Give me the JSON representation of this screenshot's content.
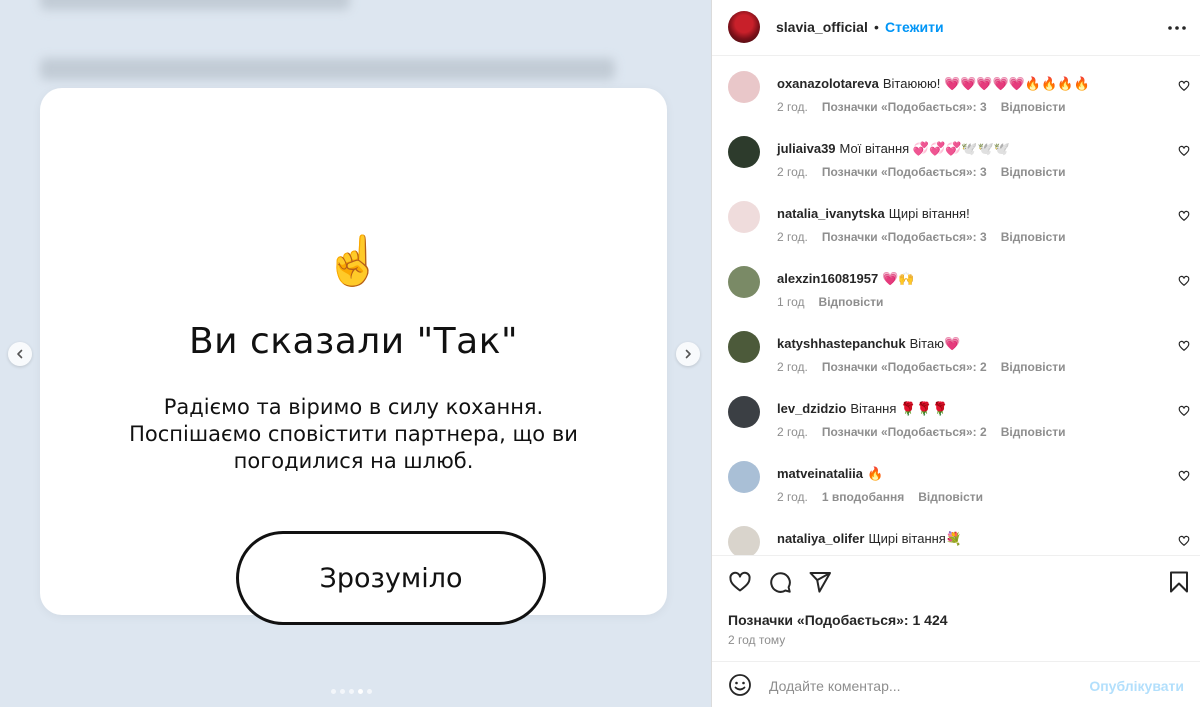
{
  "media": {
    "emoji": "☝️",
    "title": "Ви сказали \"Так\"",
    "body_lines": [
      "Радіємо та віримо в силу кохання.",
      "Поспішаємо сповістити партнера, що ви",
      "погодилися на шлюб."
    ],
    "confirm_label": "Зрозуміло",
    "carousel": {
      "count": 5,
      "active_index": 3
    }
  },
  "header": {
    "username": "slavia_official",
    "separator": "•",
    "follow_label": "Стежити"
  },
  "comments": [
    {
      "user": "oxanazolotareva",
      "text": "Вітаююю! 💗💗💗💗💗🔥🔥🔥🔥",
      "time": "2 год.",
      "likes": "Позначки «Подобається»: 3",
      "reply": "Відповісти",
      "avatar_color": "#e9c7c9"
    },
    {
      "user": "juliaiva39",
      "text": "Мої вітання 💞💞💞🕊️🕊️🕊️",
      "time": "2 год.",
      "likes": "Позначки «Подобається»: 3",
      "reply": "Відповісти",
      "avatar_color": "#2d3b2c"
    },
    {
      "user": "natalia_ivanytska",
      "text": "Щирі вітання!",
      "time": "2 год.",
      "likes": "Позначки «Подобається»: 3",
      "reply": "Відповісти",
      "avatar_color": "#efdcdc"
    },
    {
      "user": "alexzin16081957",
      "text": "💗🙌",
      "time": "1 год",
      "likes": "",
      "reply": "Відповісти",
      "avatar_color": "#7a8a66"
    },
    {
      "user": "katyshhastepanchuk",
      "text": "Вітаю💗",
      "time": "2 год.",
      "likes": "Позначки «Подобається»: 2",
      "reply": "Відповісти",
      "avatar_color": "#4c5a3a"
    },
    {
      "user": "lev_dzidzio",
      "text": "Вітання 🌹🌹🌹",
      "time": "2 год.",
      "likes": "Позначки «Подобається»: 2",
      "reply": "Відповісти",
      "avatar_color": "#3b3f44"
    },
    {
      "user": "matveinataliia",
      "text": "🔥",
      "time": "2 год.",
      "likes": "1 вподобання",
      "reply": "Відповісти",
      "avatar_color": "#a9bfd6"
    },
    {
      "user": "nataliya_olifer",
      "text": "Щирі вітання💐",
      "time": "",
      "likes": "",
      "reply": "",
      "avatar_color": "#d9d4cc"
    }
  ],
  "likes_line": "Позначки «Подобається»: 1 424",
  "time_ago": "2 год тому",
  "composer": {
    "placeholder": "Додайте коментар...",
    "publish_label": "Опублікувати"
  },
  "colors": {
    "link_blue": "#0095f6",
    "publish_disabled": "#b2dffc",
    "media_bg": "#dde6f0"
  },
  "icons": [
    "more-icon",
    "heart-icon",
    "comment-icon",
    "share-icon",
    "bookmark-icon",
    "emoji-icon",
    "chevron-left-icon",
    "chevron-right-icon"
  ]
}
